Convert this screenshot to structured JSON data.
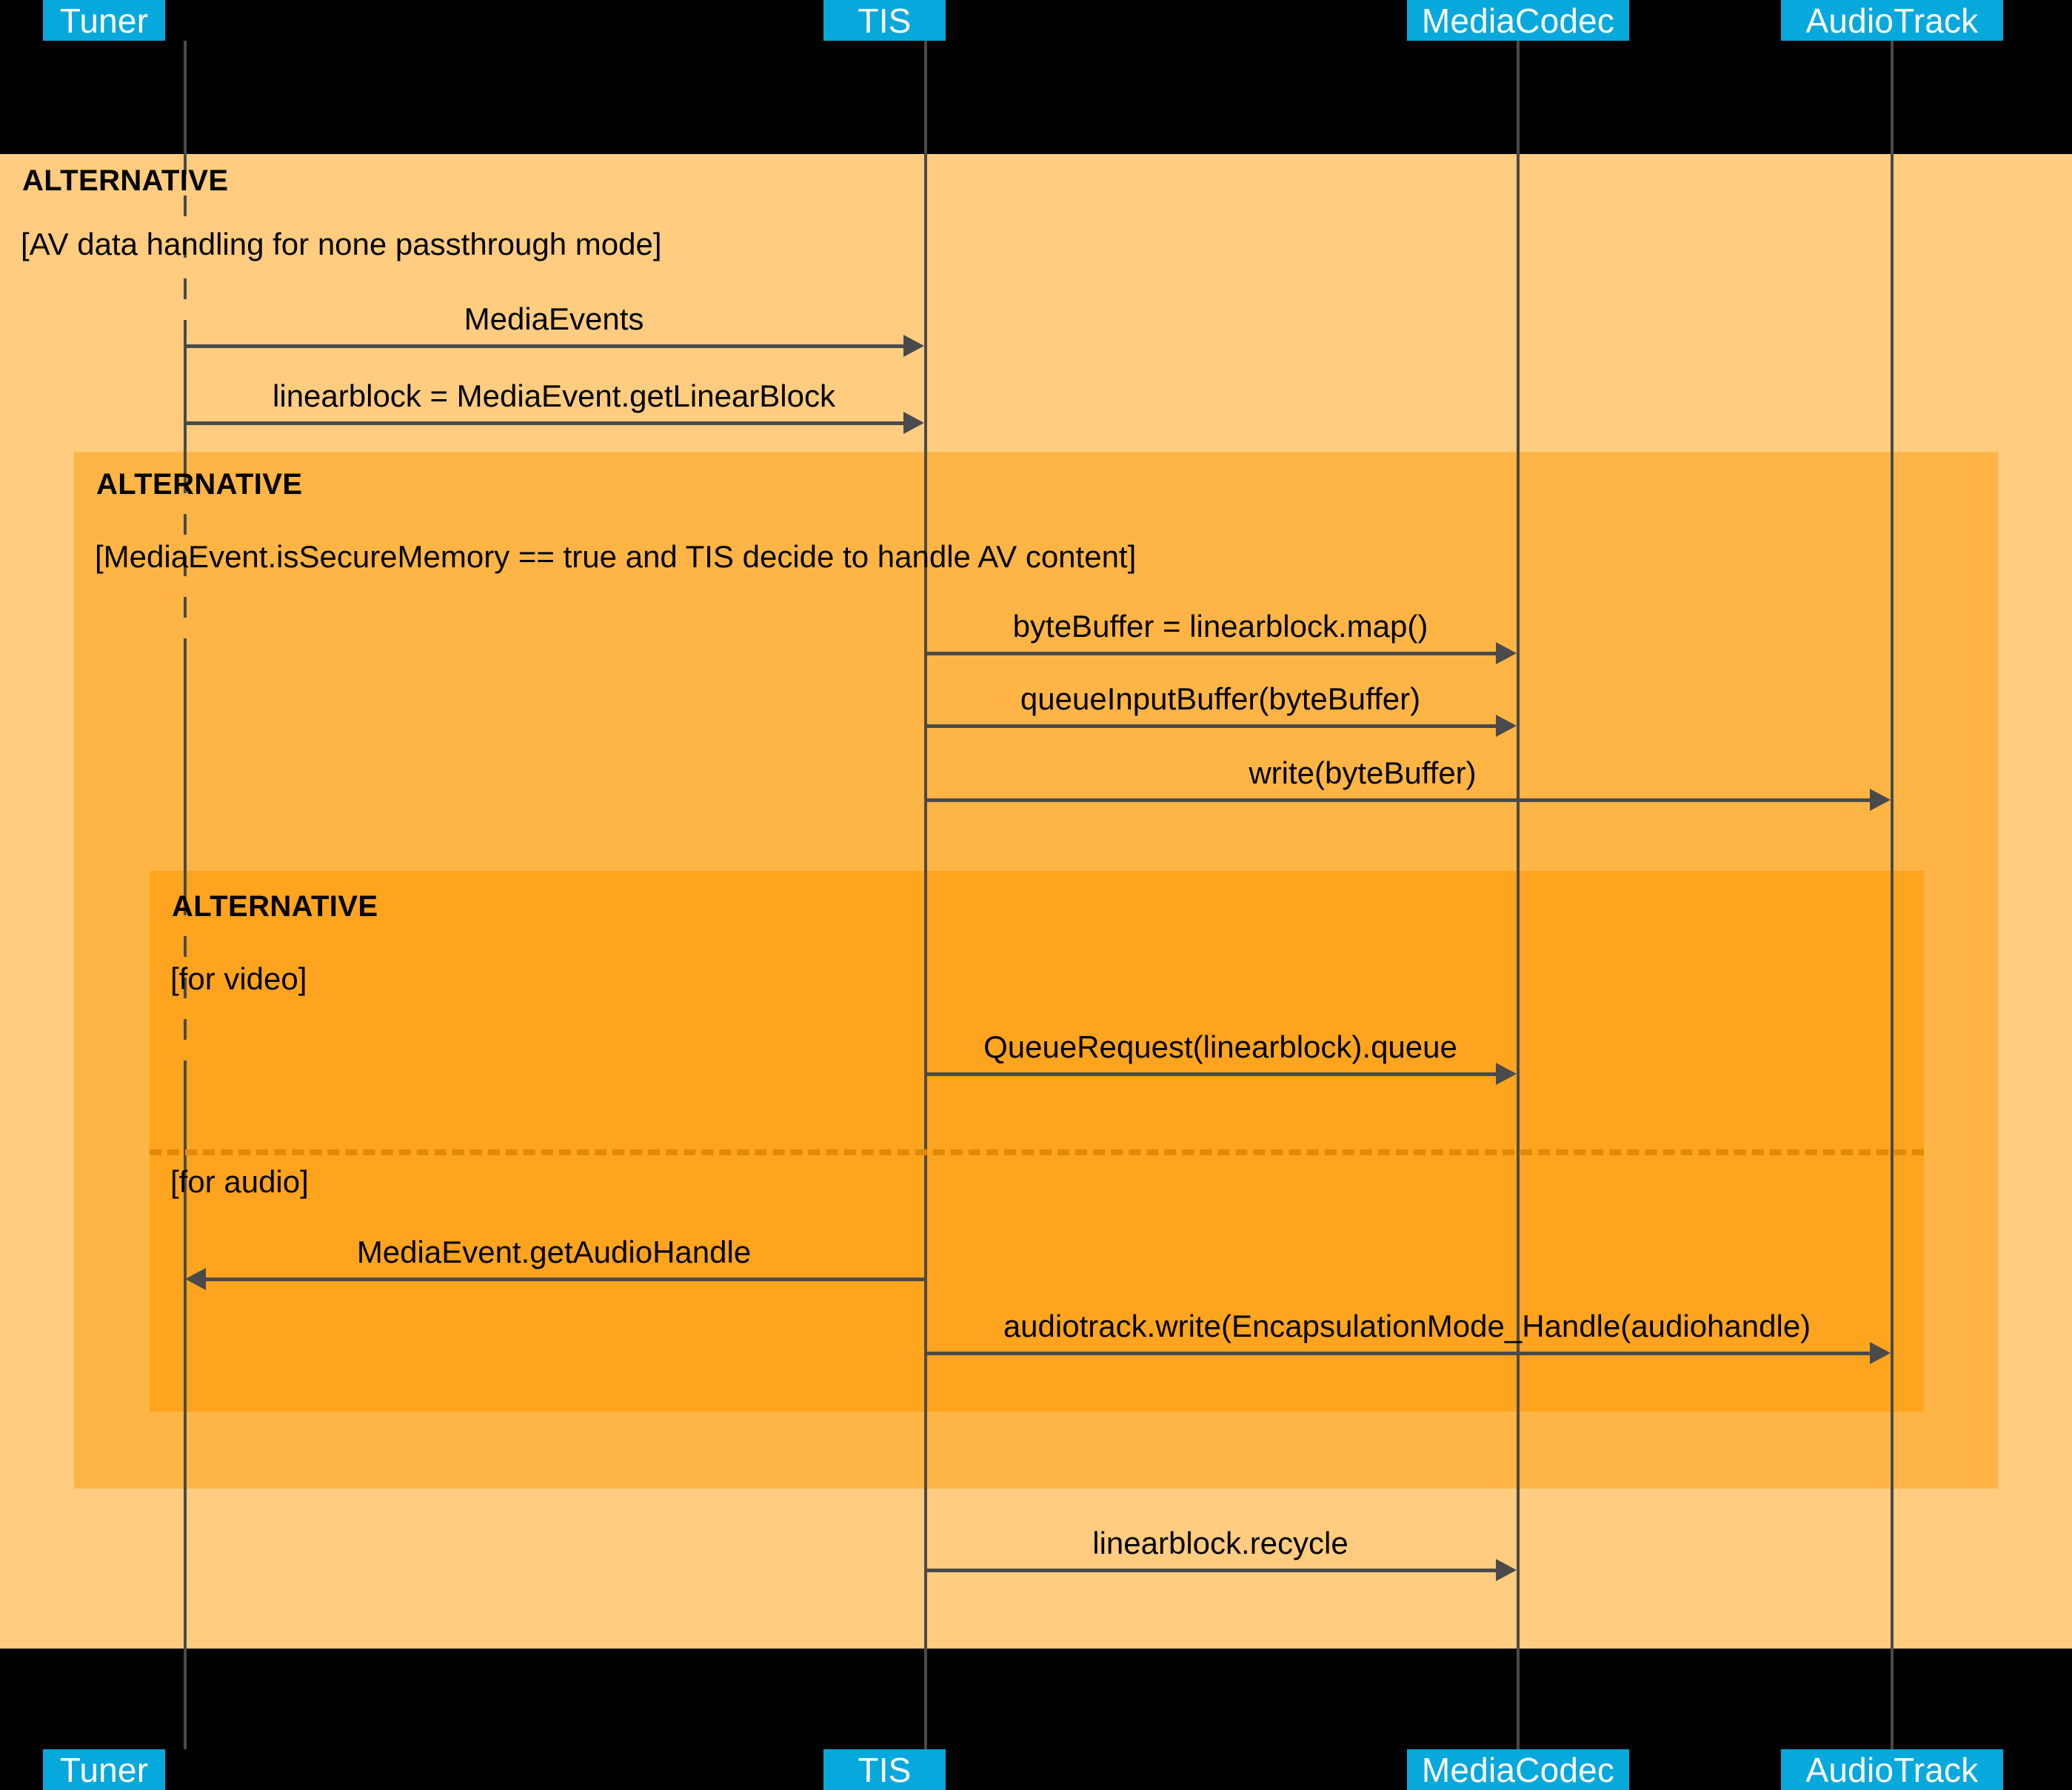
{
  "diagram": {
    "type": "uml-sequence-diagram",
    "colors": {
      "background": "#000000",
      "participant_box": "#07A8DC",
      "participant_label": "#FFFFFF",
      "frame_level_1": "#FFCC80",
      "frame_level_2": "#FFB545",
      "frame_level_3": "#FFA41E",
      "line": "#4A4A4A",
      "divider": "#E08A0A"
    }
  },
  "participants": [
    {
      "id": "tuner",
      "label": "Tuner"
    },
    {
      "id": "tis",
      "label": "TIS"
    },
    {
      "id": "mediacodec",
      "label": "MediaCodec"
    },
    {
      "id": "audiotrack",
      "label": "AudioTrack"
    }
  ],
  "fragments": [
    {
      "id": "alt-outer",
      "operator": "ALTERNATIVE",
      "guards": [
        "[AV data handling for none passthrough mode]"
      ]
    },
    {
      "id": "alt-middle",
      "operator": "ALTERNATIVE",
      "guards": [
        "[MediaEvent.isSecureMemory == true and TIS decide to handle AV content]"
      ]
    },
    {
      "id": "alt-inner",
      "operator": "ALTERNATIVE",
      "guards": [
        "[for video]",
        "[for audio]"
      ]
    }
  ],
  "messages": [
    {
      "id": "m1",
      "from": "tuner",
      "to": "tis",
      "label": "MediaEvents"
    },
    {
      "id": "m2",
      "from": "tuner",
      "to": "tis",
      "label": "linearblock = MediaEvent.getLinearBlock"
    },
    {
      "id": "m3",
      "from": "tis",
      "to": "mediacodec",
      "label": "byteBuffer = linearblock.map()"
    },
    {
      "id": "m4",
      "from": "tis",
      "to": "mediacodec",
      "label": "queueInputBuffer(byteBuffer)"
    },
    {
      "id": "m5",
      "from": "tis",
      "to": "audiotrack",
      "label": "write(byteBuffer)"
    },
    {
      "id": "m6",
      "from": "tis",
      "to": "mediacodec",
      "label": "QueueRequest(linearblock).queue"
    },
    {
      "id": "m7",
      "from": "tis",
      "to": "tuner",
      "label": "MediaEvent.getAudioHandle"
    },
    {
      "id": "m8",
      "from": "tis",
      "to": "audiotrack",
      "label": "audiotrack.write(EncapsulationMode_Handle(audiohandle)"
    },
    {
      "id": "m9",
      "from": "tis",
      "to": "mediacodec",
      "label": "linearblock.recycle"
    }
  ]
}
